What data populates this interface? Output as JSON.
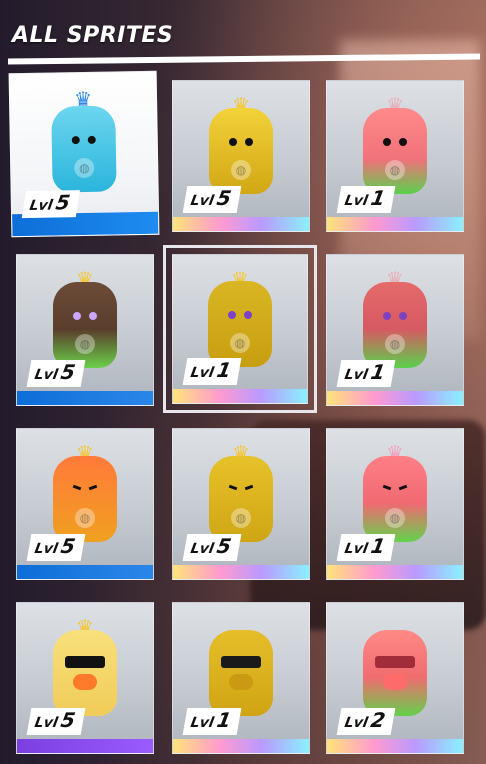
{
  "header": {
    "title": "ALL SPRITES"
  },
  "colors": {
    "sprite_blue": "#44c8e8",
    "sprite_gold": "#e0b81e",
    "sprite_pink": "#ef7a78",
    "sprite_orange": "#f08a2a",
    "sprite_green": "#5cc24a",
    "sprite_brown": "#6b4c38",
    "crown": "#f6c62b"
  },
  "sprites": [
    {
      "lvl_prefix": "Lvl",
      "lvl": "5",
      "variant": "blue",
      "rarity": "blue"
    },
    {
      "lvl_prefix": "Lvl",
      "lvl": "5",
      "variant": "gold",
      "rarity": "rainbow"
    },
    {
      "lvl_prefix": "Lvl",
      "lvl": "1",
      "variant": "pink-green",
      "rarity": "rainbow"
    },
    {
      "lvl_prefix": "Lvl",
      "lvl": "5",
      "variant": "wood-green",
      "rarity": "blue"
    },
    {
      "lvl_prefix": "Lvl",
      "lvl": "1",
      "variant": "gold-wood",
      "rarity": "rainbow",
      "selected": true
    },
    {
      "lvl_prefix": "Lvl",
      "lvl": "1",
      "variant": "pink-wood-green",
      "rarity": "rainbow"
    },
    {
      "lvl_prefix": "Lvl",
      "lvl": "5",
      "variant": "orange",
      "rarity": "blue"
    },
    {
      "lvl_prefix": "Lvl",
      "lvl": "5",
      "variant": "gold-angry",
      "rarity": "rainbow"
    },
    {
      "lvl_prefix": "Lvl",
      "lvl": "1",
      "variant": "pink-angry-green",
      "rarity": "rainbow"
    },
    {
      "lvl_prefix": "Lvl",
      "lvl": "5",
      "variant": "duck-sunglasses",
      "rarity": "purple"
    },
    {
      "lvl_prefix": "Lvl",
      "lvl": "1",
      "variant": "gold-duck-sunglasses",
      "rarity": "rainbow"
    },
    {
      "lvl_prefix": "Lvl",
      "lvl": "2",
      "variant": "pink-duck-sunglasses",
      "rarity": "rainbow"
    }
  ]
}
